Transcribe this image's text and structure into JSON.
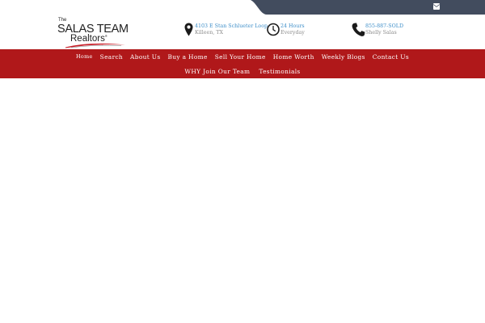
{
  "colors": {
    "topbar": "#424c5e",
    "nav_background": "#b0181a",
    "link_blue": "#3f8fc9",
    "muted_text": "#8c8c8c",
    "logo_swoosh": "#c8202a"
  },
  "social": [
    {
      "icon": "facebook-icon"
    },
    {
      "icon": "instagram-icon"
    },
    {
      "icon": "envelope-icon"
    }
  ],
  "logo": {
    "the": "The",
    "team": "SALAS TEAM",
    "realtors": "Realtors",
    "mark": "®"
  },
  "contacts": {
    "address": {
      "icon": "map-pin-icon",
      "line1": "4103 E Stan Schlueter Loop",
      "line2": "Killeen, TX"
    },
    "hours": {
      "icon": "clock-icon",
      "line1": "24 Hours",
      "line2": "Everyday"
    },
    "phone": {
      "icon": "phone-icon",
      "line1": "855-887-SOLD",
      "line2": "Shelly Salas"
    }
  },
  "nav": {
    "row1": [
      "Home",
      "Search",
      "About Us",
      "Buy a Home",
      "Sell Your Home",
      "Home Worth",
      "Weekly Blogs",
      "Contact Us"
    ],
    "row2": [
      "WHY Join Our Team",
      "Testimonials"
    ],
    "active": "Home"
  }
}
